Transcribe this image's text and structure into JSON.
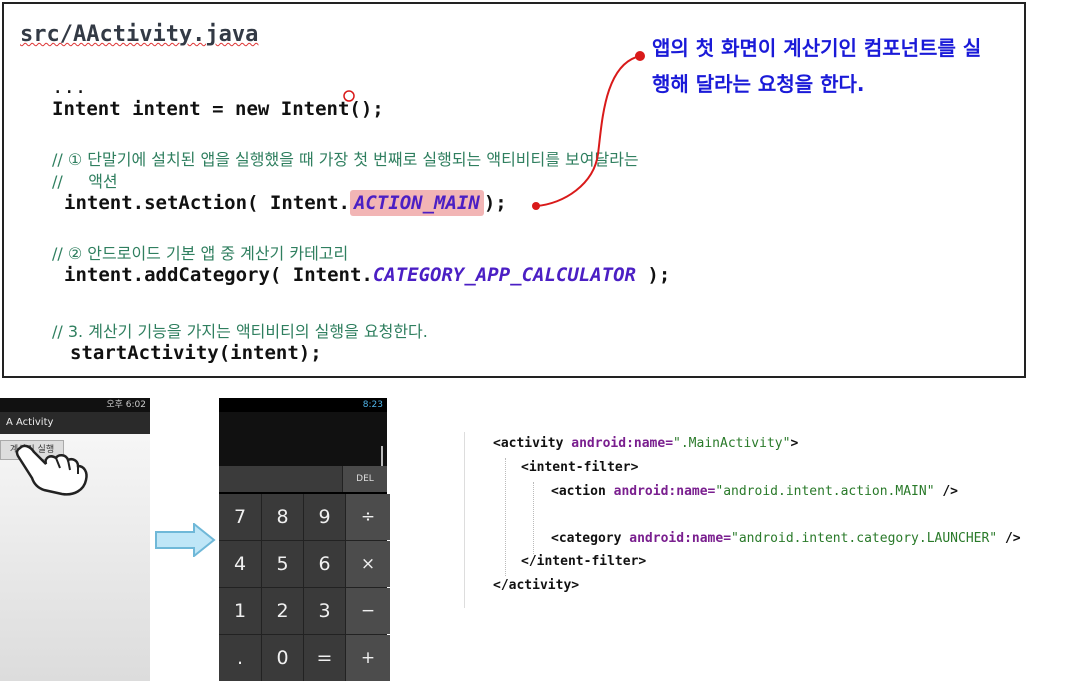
{
  "code_panel": {
    "file_title": "src/AActivity.java",
    "lines": {
      "ellipsis": "...",
      "intent_decl": "Intent intent = new Intent();",
      "comment1a": "// ① 단말기에 설치된 앱을 실행했을 때 가장 첫 번째로 실행되는 액티비티를 보여달라는",
      "comment1b": "//     액션",
      "set_action_prefix": "intent.setAction( Intent.",
      "set_action_const": "ACTION_MAIN",
      "set_action_suffix": ");",
      "comment2": "// ② 안드로이드 기본 앱 중 계산기 카테고리",
      "add_category_prefix": "intent.addCategory( Intent.",
      "add_category_const": "CATEGORY_APP_CALCULATOR",
      "add_category_suffix": " );",
      "comment3": "// 3. 계산기 기능을 가지는 액티비티의 실행을 요청한다.",
      "start_activity": "startActivity(intent);"
    },
    "annotation": {
      "line1": "앱의 첫 화면이 계산기인 컴포넌트를 실",
      "line2": "행해 달라는 요청을 한다."
    }
  },
  "phone_left": {
    "status": "오후 6:02",
    "title": "A Activity",
    "button": "계산기 실행"
  },
  "calculator": {
    "status": "8:23",
    "del_label": "DEL",
    "keys": [
      "7",
      "8",
      "9",
      "÷",
      "4",
      "5",
      "6",
      "×",
      "1",
      "2",
      "3",
      "−",
      ".",
      "0",
      "=",
      "+"
    ]
  },
  "xml": {
    "line1": {
      "open": "<activity ",
      "attr": "android:name=",
      "val": "\".MainActivity\"",
      "close": ">"
    },
    "line2": {
      "text": "<intent-filter>"
    },
    "line3": {
      "open": "<action ",
      "attr": "android:name=",
      "val": "\"android.intent.action.MAIN\"",
      "close": " />"
    },
    "line4": {
      "open": "<category ",
      "attr": "android:name=",
      "val": "\"android.intent.category.LAUNCHER\"",
      "close": " />"
    },
    "line5": {
      "text": "</intent-filter>"
    },
    "line6": {
      "text": "</activity>"
    }
  },
  "colors": {
    "accent_blue": "#1a1ad8",
    "highlight": "#f2b5b5",
    "connector": "#d91a1a"
  }
}
